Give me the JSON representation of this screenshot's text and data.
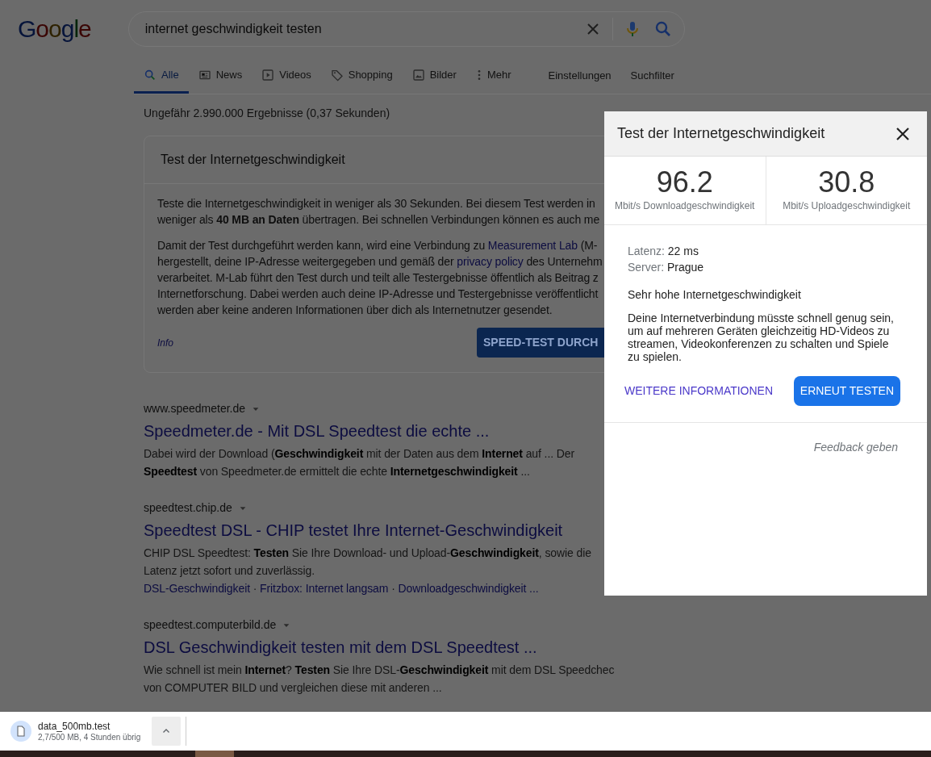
{
  "logo": "Google",
  "search": {
    "query": "internet geschwindigkeit testen"
  },
  "tabs": [
    {
      "label": "Alle",
      "kind": "search",
      "selected": true
    },
    {
      "label": "News",
      "kind": "news",
      "selected": false
    },
    {
      "label": "Videos",
      "kind": "play",
      "selected": false
    },
    {
      "label": "Shopping",
      "kind": "tag",
      "selected": false
    },
    {
      "label": "Bilder",
      "kind": "image",
      "selected": false
    },
    {
      "label": "Mehr",
      "kind": "dots",
      "selected": false
    }
  ],
  "tools": [
    "Einstellungen",
    "Suchfilter"
  ],
  "result_stats": "Ungefähr 2.990.000 Ergebnisse (0,37 Sekunden)",
  "speed_card": {
    "title": "Test der Internetgeschwindigkeit",
    "paragraphs": [
      [
        [
          {
            "text": "Teste die Internetgeschwindigkeit in weniger als 30 Sekunden. Bei diesem Test werden in"
          }
        ],
        [
          {
            "text": "weniger als **40 MB an Daten** übertragen. Bei schnellen Verbindungen können es auch me"
          }
        ]
      ],
      [
        [
          {
            "text": "Damit der Test durchgeführt werden kann, wird eine Verbindung zu "
          },
          {
            "text": "Measurement Lab",
            "link": true
          },
          {
            "text": " (M-"
          }
        ],
        [
          {
            "text": "hergestellt, deine IP-Adresse weitergegeben und gemäß der "
          },
          {
            "text": "privacy policy",
            "link": true
          },
          {
            "text": " des Unternehm"
          }
        ],
        [
          {
            "text": "verarbeitet. M-Lab führt den Test durch und teilt alle Testergebnisse öffentlich als Beitrag z"
          }
        ],
        [
          {
            "text": "Internetforschung. Dabei werden auch deine IP-Adresse und Testergebnisse veröffentlicht"
          }
        ],
        [
          {
            "text": "werden aber keine anderen Informationen über dich als Internetnutzer gesendet."
          }
        ]
      ]
    ],
    "info_link": "Info",
    "button": "SPEED-TEST DURCH"
  },
  "results": [
    {
      "url": "www.speedmeter.de",
      "title": "Speedmeter.de - Mit DSL Speedtest die echte ...",
      "snippet_lines": [
        "Dabei wird der Download (**Geschwindigkeit** mit der Daten aus dem **Internet** auf ... Der",
        "**Speedtest** von Speedmeter.de ermittelt die echte **Internetgeschwindigkeit** ..."
      ]
    },
    {
      "url": "speedtest.chip.de",
      "title": "Speedtest DSL - CHIP testet Ihre Internet-Geschwindigkeit",
      "snippet_lines": [
        "CHIP DSL Speedtest: **Testen** Sie Ihre Download- und Upload-**Geschwindigkeit**, sowie die",
        "Latenz jetzt sofort und zuverlässig."
      ],
      "sitelinks": [
        "DSL-Geschwindigkeit",
        "Fritzbox: Internet langsam",
        "Downloadgeschwindigkeit ..."
      ]
    },
    {
      "url": "speedtest.computerbild.de",
      "title": "DSL Geschwindigkeit testen mit dem DSL Speedtest ...",
      "snippet_lines": [
        "Wie schnell ist mein **Internet**? **Testen** Sie Ihre DSL-**Geschwindigkeit** mit dem DSL Speedchec",
        "von COMPUTER BILD und vergleichen diese mit anderen ..."
      ]
    }
  ],
  "sitelink_separator": "·",
  "dialog": {
    "title": "Test der Internetgeschwindigkeit",
    "stats": [
      {
        "value": "96.2",
        "label": "Mbit/s Downloadgeschwindigkeit"
      },
      {
        "value": "30.8",
        "label": "Mbit/s Uploadgeschwindigkeit"
      }
    ],
    "details": [
      {
        "label": "Latenz:",
        "value": "22 ms"
      },
      {
        "label": "Server:",
        "value": "Prague"
      }
    ],
    "verdict": "Sehr hohe Internetgeschwindigkeit",
    "description": "Deine Internetverbindung müsste schnell genug sein, um auf mehreren Geräten gleichzeitig HD-Videos zu streamen, Videokonferenzen zu schalten und Spiele zu spielen.",
    "more_link": "WEITERE INFORMATIONEN",
    "retest_button": "ERNEUT TESTEN",
    "feedback": "Feedback geben"
  },
  "download": {
    "filename": "data_500mb.test",
    "progress": "2,7/500 MB, 4 Stunden übrig"
  }
}
